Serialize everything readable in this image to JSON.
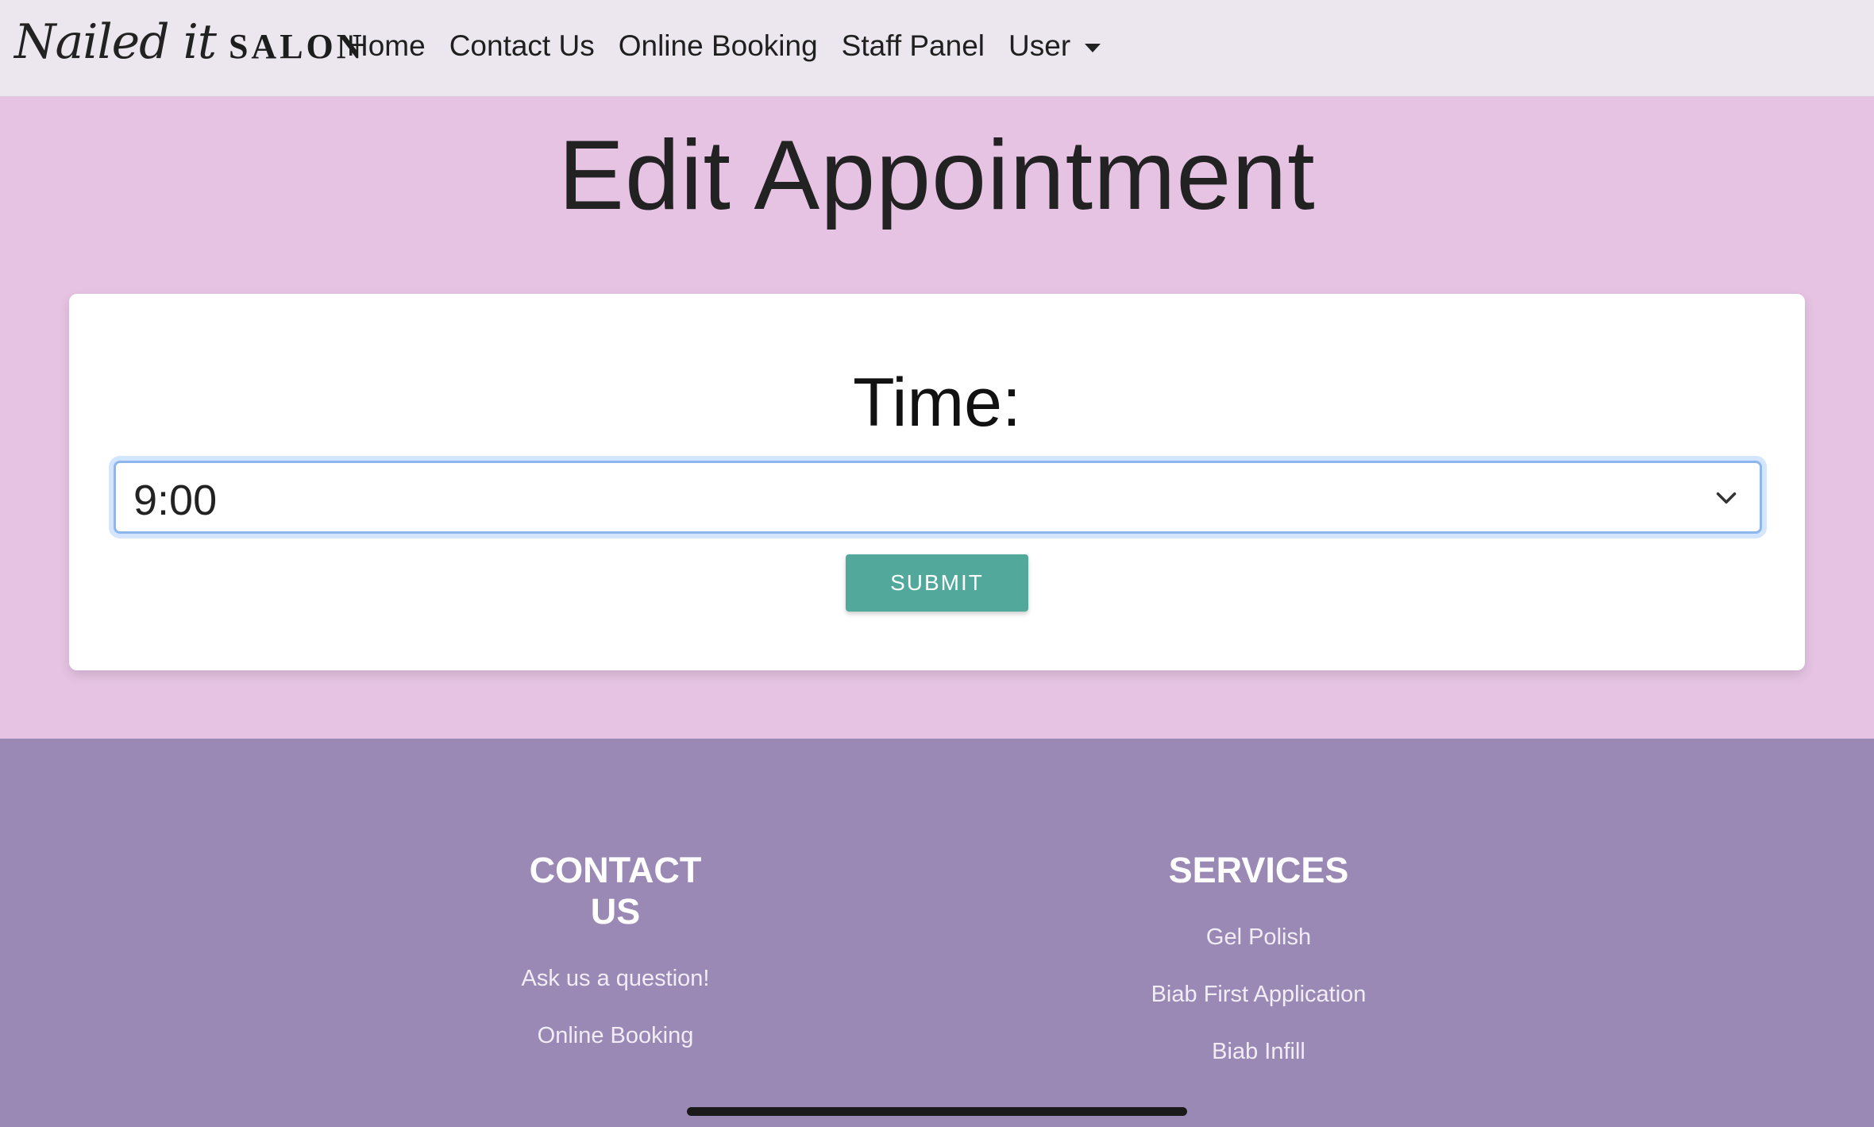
{
  "nav": {
    "brand_script": "Nailed it",
    "brand_salon": "SALON",
    "links": [
      "Home",
      "Contact Us",
      "Online Booking",
      "Staff Panel"
    ],
    "user_label": "User"
  },
  "page": {
    "title": "Edit Appointment"
  },
  "form": {
    "time_label": "Time:",
    "time_selected": "9:00",
    "submit_label": "SUBMIT"
  },
  "footer": {
    "contact_heading": "CONTACT US",
    "contact_links": [
      "Ask us a question!",
      "Online Booking"
    ],
    "services_heading": "SERVICES",
    "services_links": [
      "Gel Polish",
      "Biab First Application",
      "Biab Infill"
    ]
  },
  "colors": {
    "page_bg": "#e6c3e3",
    "nav_bg": "#ece6ee",
    "footer_bg": "#9a89b5",
    "submit_bg": "#52a89a",
    "focus_ring": "#8eb6ee"
  }
}
